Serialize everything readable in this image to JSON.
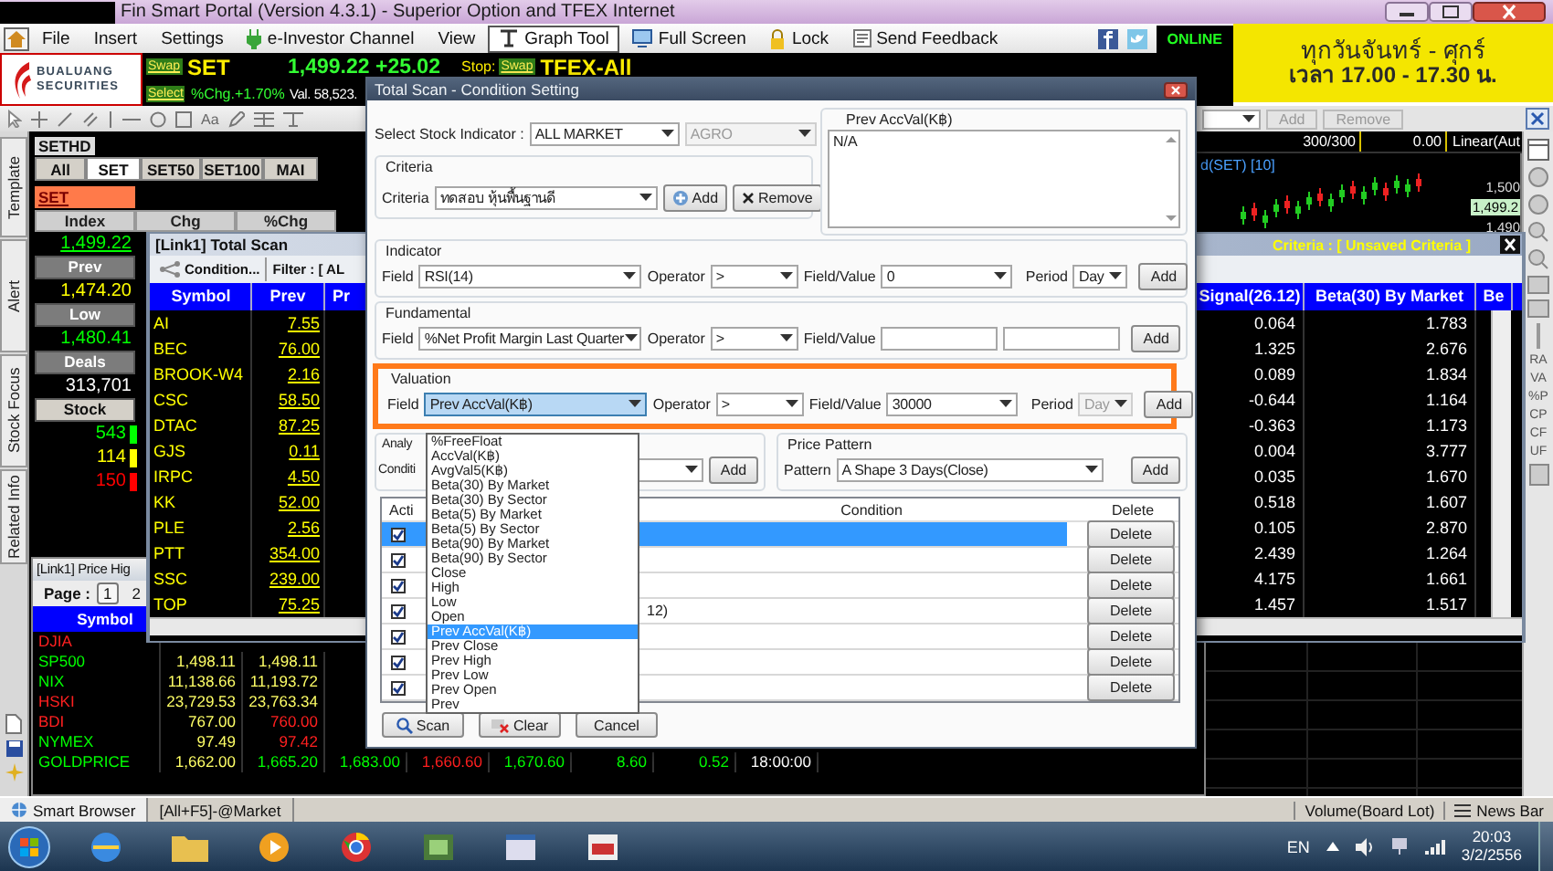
{
  "window": {
    "title": "Fin Smart Portal (Version 4.3.1) - Superior Option and TFEX Internet"
  },
  "menu": [
    {
      "label": "File",
      "selected": false
    },
    {
      "label": "Insert",
      "selected": false
    },
    {
      "label": "Settings",
      "selected": false
    },
    {
      "label": "e-Investor Channel",
      "selected": false
    },
    {
      "label": "View",
      "selected": false
    },
    {
      "label": "Graph Tool",
      "selected": true
    },
    {
      "label": "Full Screen",
      "selected": false
    },
    {
      "label": "Lock",
      "selected": false
    },
    {
      "label": "Send Feedback",
      "selected": false
    }
  ],
  "connection": {
    "status": "ONLINE"
  },
  "banner": {
    "lines": [
      "ทุกวันจันทร์ - ศุกร์",
      "เวลา 17.00 - 17.30 น."
    ]
  },
  "logo": {
    "lines": [
      "BUALUANG",
      "SECURITIES"
    ]
  },
  "ticker": {
    "swap_button": "Swap",
    "select_button": "Select",
    "index": "SET",
    "value": "1,499.22 +25.02",
    "change": "%Chg.+1.70%",
    "turnover": "Val. 58,523.",
    "stop_label": "Stop:",
    "stop_swap_button": "Swap",
    "tfex": "TFEX-All"
  },
  "drawing_toolbar": {
    "text_tool": "Aa"
  },
  "chart": {
    "add_button": {
      "label": "Add",
      "disabled": true
    },
    "remove_button": {
      "label": "Remove",
      "disabled": true
    },
    "scale": [
      "300/300",
      "0.00",
      "Linear(Aut"
    ],
    "series_label": "d(SET) [10]",
    "price_labels": [
      {
        "label": "1,500",
        "current": false
      },
      {
        "label": "1,499.2",
        "current": true
      },
      {
        "label": "1,490",
        "current": false
      }
    ]
  },
  "side_tabs": [
    "Template",
    "Alert",
    "Stock Focus",
    "Related Info"
  ],
  "market_panel": {
    "title": "SETHD",
    "tabs": [
      {
        "label": "All",
        "selected": false
      },
      {
        "label": "SET",
        "selected": true
      },
      {
        "label": "SET50",
        "selected": false
      },
      {
        "label": "SET100",
        "selected": false
      },
      {
        "label": "MAI",
        "selected": false
      }
    ],
    "index_name": "SET",
    "columns": [
      "Index",
      "Chg",
      "%Chg"
    ],
    "index_value": "1,499.22",
    "stats": [
      {
        "label": "Prev",
        "value": "1,474.20",
        "up": false,
        "unchanged": true
      },
      {
        "label": "Low",
        "value": "1,480.41",
        "up": true,
        "unchanged": false
      },
      {
        "label": "Deals",
        "value": "313,701",
        "up": false,
        "unchanged": false
      }
    ],
    "stock_label": "Stock",
    "breadth": [
      {
        "value": "543",
        "color": "#00ff00"
      },
      {
        "value": "114",
        "color": "#ffff00"
      },
      {
        "value": "150",
        "color": "#ff0000"
      }
    ]
  },
  "right_toolbar": {
    "labels": [
      "RA",
      "VA",
      "%P",
      "CP",
      "CF",
      "UF"
    ]
  },
  "total_scan": {
    "title": "[Link1] Total Scan",
    "criteria": "Criteria : [ Unsaved Criteria ]",
    "condition_button": "Condition...",
    "filter_label": "Filter : [ AL",
    "columns": [
      "Symbol",
      "Prev",
      "Pr",
      "Signal(26.12)",
      "Beta(30) By Market",
      "Be"
    ],
    "rows": [
      {
        "symbol": "AI",
        "prev": "7.55",
        "signal": "0.064",
        "beta": "1.783"
      },
      {
        "symbol": "BEC",
        "prev": "76.00",
        "signal": "1.325",
        "beta": "2.676"
      },
      {
        "symbol": "BROOK-W4",
        "prev": "2.16",
        "signal": "0.089",
        "beta": "1.834"
      },
      {
        "symbol": "CSC",
        "prev": "58.50",
        "signal": "-0.644",
        "beta": "1.164"
      },
      {
        "symbol": "DTAC",
        "prev": "87.25",
        "signal": "-0.363",
        "beta": "1.173"
      },
      {
        "symbol": "GJS",
        "prev": "0.11",
        "signal": "0.004",
        "beta": "3.777"
      },
      {
        "symbol": "IRPC",
        "prev": "4.50",
        "signal": "0.035",
        "beta": "1.670"
      },
      {
        "symbol": "KK",
        "prev": "52.00",
        "signal": "0.518",
        "beta": "1.607"
      },
      {
        "symbol": "PLE",
        "prev": "2.56",
        "signal": "0.105",
        "beta": "2.870"
      },
      {
        "symbol": "PTT",
        "prev": "354.00",
        "signal": "2.439",
        "beta": "1.264"
      },
      {
        "symbol": "SSC",
        "prev": "239.00",
        "signal": "4.175",
        "beta": "1.661"
      },
      {
        "symbol": "TOP",
        "prev": "75.25",
        "signal": "1.457",
        "beta": "1.517"
      }
    ]
  },
  "price_window": {
    "title": "[Link1] Price Hig",
    "page_label": "Page :",
    "pages": [
      {
        "label": "1",
        "selected": true
      },
      {
        "label": "2",
        "selected": false
      }
    ],
    "symbol_column": "Symbol",
    "rows": [
      {
        "symbol": "DJIA",
        "color": "#ff2020"
      },
      {
        "symbol": "SP500",
        "color": "#00ff00",
        "values": [
          {
            "text": "1,498.11",
            "color": "#ffff66"
          },
          {
            "text": "1,498.11",
            "color": "#ffff66"
          }
        ]
      },
      {
        "symbol": "NIX",
        "color": "#00ff00",
        "values": [
          {
            "text": "11,138.66",
            "color": "#ffff66"
          },
          {
            "text": "11,193.72",
            "color": "#ffff66"
          }
        ]
      },
      {
        "symbol": "HSKI",
        "color": "#ff2020",
        "values": [
          {
            "text": "23,729.53",
            "color": "#ffff66"
          },
          {
            "text": "23,763.34",
            "color": "#ffff66"
          }
        ]
      },
      {
        "symbol": "BDI",
        "color": "#ff2020",
        "values": [
          {
            "text": "767.00",
            "color": "#ffff66"
          },
          {
            "text": "760.00",
            "color": "#ff2020"
          }
        ]
      },
      {
        "symbol": "NYMEX",
        "color": "#00ff00",
        "values": [
          {
            "text": "97.49",
            "color": "#ffff66"
          },
          {
            "text": "97.42",
            "color": "#ff2020"
          }
        ]
      },
      {
        "symbol": "GOLDPRICE",
        "color": "#00ff00",
        "values": [
          {
            "text": "1,662.00",
            "color": "#ffff66"
          },
          {
            "text": "1,665.20",
            "color": "#00ff00"
          },
          {
            "text": "1,683.00",
            "color": "#00ff00"
          },
          {
            "text": "1,660.60",
            "color": "#ff2020"
          },
          {
            "text": "1,670.60",
            "color": "#00ff00"
          },
          {
            "text": "8.60",
            "color": "#00ff00"
          },
          {
            "text": "0.52",
            "color": "#00ff00"
          },
          {
            "text": "18:00:00",
            "color": "#ffffff"
          }
        ]
      }
    ]
  },
  "dialog": {
    "title": "Total Scan - Condition Setting",
    "stock_indicator": {
      "label": "Select Stock Indicator :",
      "market": "ALL MARKET",
      "sector": {
        "value": "AGRO",
        "disabled": true
      }
    },
    "preview": {
      "title": "Prev AccVal(K฿)",
      "text": "N/A"
    },
    "criteria": {
      "group": "Criteria",
      "label": "Criteria",
      "value": "ทดสอบ หุ้นพื้นฐานดี",
      "add_button": "Add",
      "remove_button": "Remove"
    },
    "sections": [
      {
        "kind": "period",
        "title": "Indicator",
        "field_label": "Field",
        "field": "RSI(14)",
        "field_focused": false,
        "operator_label": "Operator",
        "operator": ">",
        "value_label": "Field/Value",
        "value": "0",
        "period_label": "Period",
        "period": {
          "value": "Day",
          "disabled": false
        },
        "add_button": "Add",
        "highlighted": false
      },
      {
        "kind": "range",
        "title": "Fundamental",
        "field_label": "Field",
        "field": "%Net Profit Margin Last Quarter",
        "field_focused": false,
        "operator_label": "Operator",
        "operator": ">",
        "value_label": "Field/Value",
        "add_button": "Add",
        "highlighted": false
      },
      {
        "kind": "period",
        "title": "Valuation",
        "field_label": "Field",
        "field": "Prev AccVal(K฿)",
        "field_focused": true,
        "operator_label": "Operator",
        "operator": ">",
        "value_label": "Field/Value",
        "value": "30000",
        "period_label": "Period",
        "period": {
          "value": "Day",
          "disabled": true
        },
        "add_button": "Add",
        "highlighted": true
      }
    ],
    "dropdown": [
      {
        "label": "%FreeFloat",
        "selected": false
      },
      {
        "label": "AccVal(K฿)",
        "selected": false
      },
      {
        "label": "AvgVal5(K฿)",
        "selected": false
      },
      {
        "label": "Beta(30) By Market",
        "selected": false
      },
      {
        "label": "Beta(30) By Sector",
        "selected": false
      },
      {
        "label": "Beta(5) By Market",
        "selected": false
      },
      {
        "label": "Beta(5) By Sector",
        "selected": false
      },
      {
        "label": "Beta(90) By Market",
        "selected": false
      },
      {
        "label": "Beta(90) By Sector",
        "selected": false
      },
      {
        "label": "Close",
        "selected": false
      },
      {
        "label": "High",
        "selected": false
      },
      {
        "label": "Low",
        "selected": false
      },
      {
        "label": "Open",
        "selected": false
      },
      {
        "label": "Prev AccVal(K฿)",
        "selected": true
      },
      {
        "label": "Prev Close",
        "selected": false
      },
      {
        "label": "Prev High",
        "selected": false
      },
      {
        "label": "Prev Low",
        "selected": false
      },
      {
        "label": "Prev Open",
        "selected": false
      },
      {
        "label": "Prev",
        "selected": false
      }
    ],
    "analysis": {
      "title": "Analy",
      "label": "Conditi",
      "add_button": "Add"
    },
    "pattern": {
      "title": "Price Pattern",
      "label": "Pattern",
      "value": "A Shape 3 Days(Close)",
      "add_button": "Add"
    },
    "conditions": {
      "columns": [
        "Acti",
        "Condition",
        "Delete"
      ],
      "rows": [
        {
          "checked": true,
          "selected": true,
          "delete_button": "Delete"
        },
        {
          "checked": true,
          "selected": false,
          "delete_button": "Delete"
        },
        {
          "checked": true,
          "selected": false,
          "delete_button": "Delete"
        },
        {
          "checked": true,
          "selected": false,
          "text": "12)",
          "delete_button": "Delete"
        },
        {
          "checked": true,
          "selected": false,
          "delete_button": "Delete"
        },
        {
          "checked": true,
          "selected": false,
          "delete_button": "Delete"
        },
        {
          "checked": true,
          "selected": false,
          "delete_button": "Delete"
        }
      ]
    },
    "buttons": [
      "Scan",
      "Clear",
      "Cancel"
    ]
  },
  "status_bar": {
    "tabs": [
      "Smart Browser",
      "[All+F5]-@Market"
    ],
    "right": [
      "Volume(Board Lot)",
      "News Bar"
    ]
  },
  "taskbar": {
    "language": "EN",
    "time": "20:03",
    "date": "3/2/2556"
  }
}
